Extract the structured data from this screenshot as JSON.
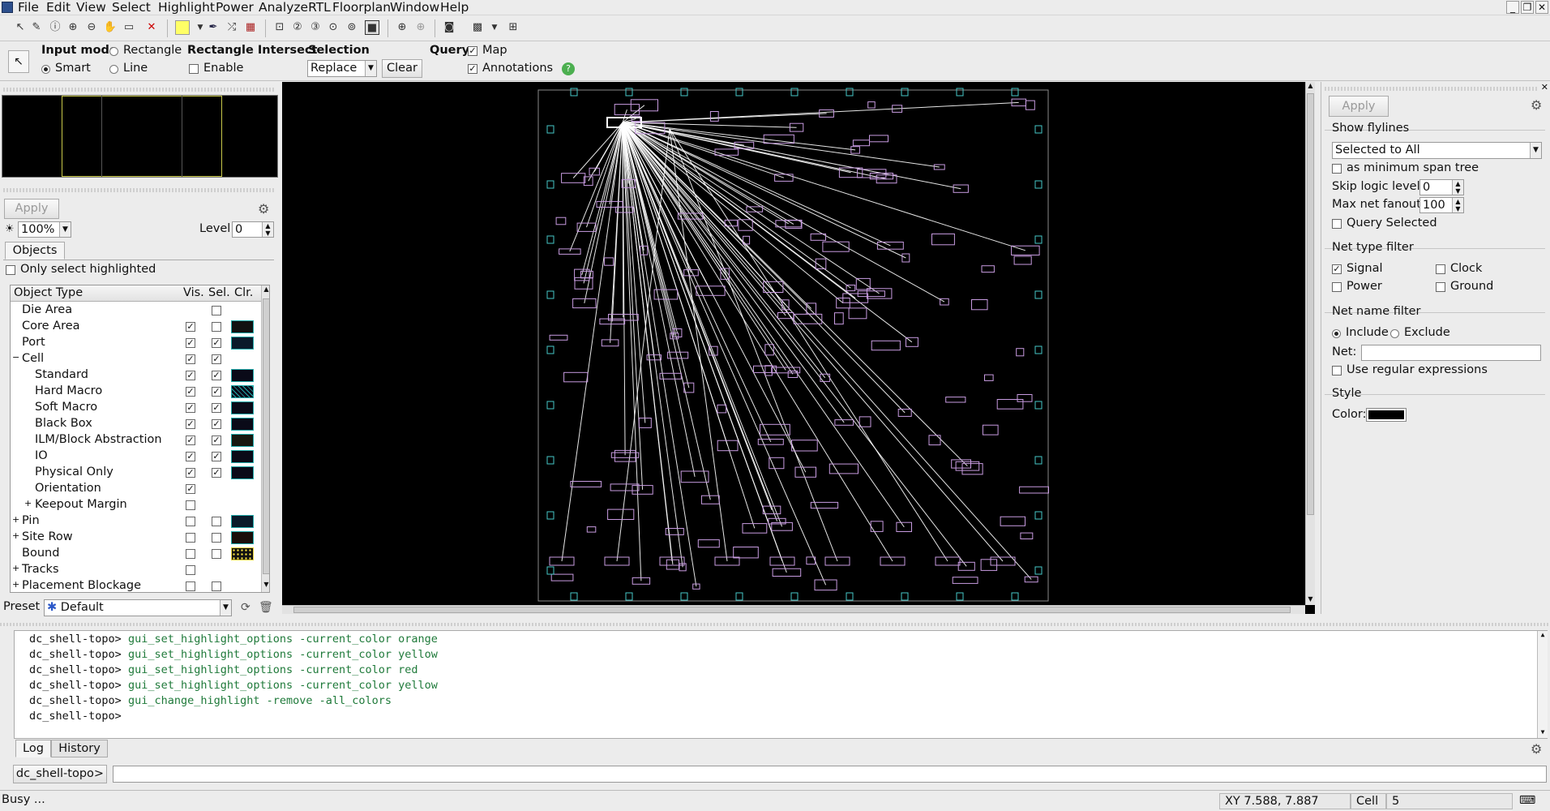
{
  "menu": [
    "File",
    "Edit",
    "View",
    "Select",
    "Highlight",
    "Power",
    "AnalyzeRTL",
    "Floorplan",
    "Window",
    "Help"
  ],
  "optbar": {
    "input_mode_label": "Input mode",
    "rectangle_label": "Rectangle",
    "smart_label": "Smart",
    "line_label": "Line",
    "rect_intersect_label": "Rectangle Intersect",
    "enable_label": "Enable",
    "selection_label": "Selection",
    "selection_value": "Replace",
    "clear_label": "Clear",
    "query_label": "Query",
    "map_label": "Map",
    "annotations_label": "Annotations",
    "help_icon": "?"
  },
  "left": {
    "apply_label": "Apply",
    "zoom_value": "100%",
    "level_label": "Level",
    "level_value": "0",
    "objects_tab": "Objects",
    "only_highlighted_label": "Only select highlighted",
    "headers": {
      "type": "Object Type",
      "vis": "Vis.",
      "sel": "Sel.",
      "clr": "Clr."
    },
    "rows": [
      {
        "label": "Die Area",
        "vis": false,
        "sel": false
      },
      {
        "label": "Core Area",
        "vis": true,
        "sel": false
      },
      {
        "label": "Port",
        "vis": true,
        "sel": true
      },
      {
        "label": "Cell",
        "vis": true,
        "sel": true
      },
      {
        "label": "Standard",
        "vis": true,
        "sel": true
      },
      {
        "label": "Hard Macro",
        "vis": true,
        "sel": true
      },
      {
        "label": "Soft Macro",
        "vis": true,
        "sel": true
      },
      {
        "label": "Black Box",
        "vis": true,
        "sel": true
      },
      {
        "label": "ILM/Block Abstraction",
        "vis": true,
        "sel": true
      },
      {
        "label": "IO",
        "vis": true,
        "sel": true
      },
      {
        "label": "Physical Only",
        "vis": true,
        "sel": true
      },
      {
        "label": "Orientation",
        "vis": true,
        "sel": false
      },
      {
        "label": "Keepout Margin",
        "vis": false,
        "sel": false
      },
      {
        "label": "Pin",
        "vis": false,
        "sel": false
      },
      {
        "label": "Site Row",
        "vis": false,
        "sel": false
      },
      {
        "label": "Bound",
        "vis": false,
        "sel": false
      },
      {
        "label": "Tracks",
        "vis": false,
        "sel": false
      },
      {
        "label": "Placement Blockage",
        "vis": false,
        "sel": false
      }
    ],
    "preset_label": "Preset",
    "preset_value": "Default"
  },
  "right": {
    "apply_label": "Apply",
    "show_flylines_label": "Show flylines",
    "flylines_value": "Selected to All",
    "min_span_label": "as minimum span tree",
    "skip_logic_label": "Skip logic levels:",
    "skip_logic_value": "0",
    "max_fanout_label": "Max net fanout:",
    "max_fanout_value": "100",
    "query_selected_label": "Query Selected",
    "net_type_label": "Net type filter",
    "signal_label": "Signal",
    "clock_label": "Clock",
    "power_label": "Power",
    "ground_label": "Ground",
    "net_name_label": "Net name filter",
    "include_label": "Include",
    "exclude_label": "Exclude",
    "net_label": "Net:",
    "regex_label": "Use regular expressions",
    "style_label": "Style",
    "color_label": "Color:"
  },
  "console": {
    "prompt": "dc_shell-topo>",
    "lines": [
      "gui_set_highlight_options -current_color orange",
      "gui_set_highlight_options -current_color yellow",
      "gui_set_highlight_options -current_color red",
      "gui_set_highlight_options -current_color yellow",
      "gui_change_highlight -remove -all_colors",
      ""
    ],
    "tabs": [
      "Log",
      "History"
    ],
    "input_prompt": "dc_shell-topo>"
  },
  "status": {
    "busy": "Busy ...",
    "xy": "XY 7.588, 7.887",
    "cell_label": "Cell",
    "cell_value": "5"
  },
  "colors": {
    "canvas_bg": "#000000",
    "cell_outline": "#c79be0",
    "port_outline": "#46c8c8",
    "flyline": "#ffffff",
    "console_cmd": "#1f7a3a"
  }
}
